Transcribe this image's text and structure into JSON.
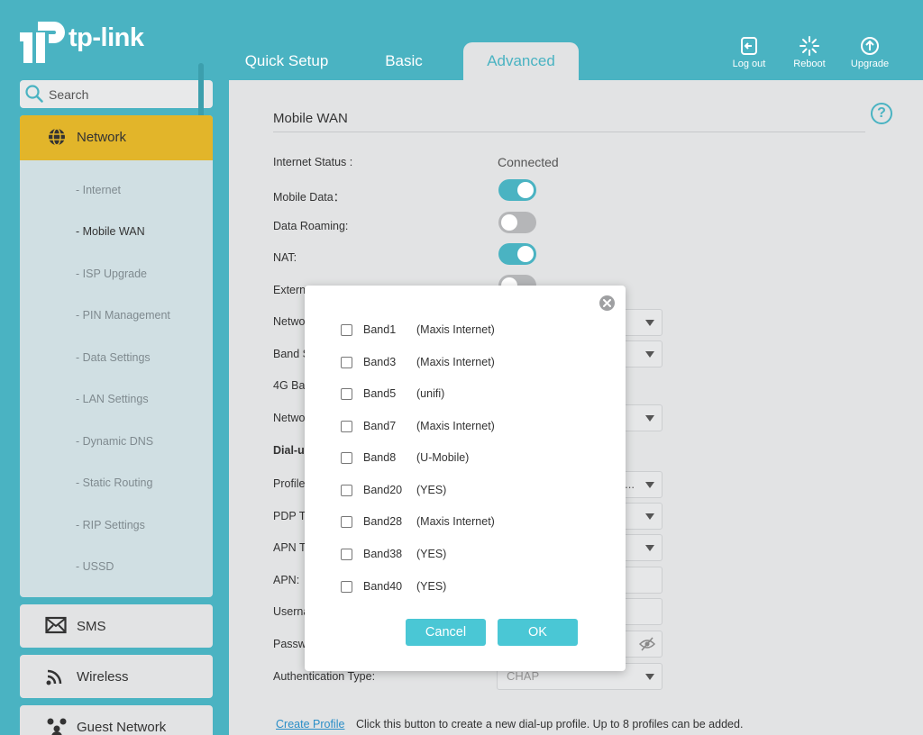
{
  "header": {
    "logo_text": "tp-link",
    "tabs": [
      {
        "label": "Quick Setup"
      },
      {
        "label": "Basic"
      },
      {
        "label": "Advanced"
      }
    ],
    "actions": [
      {
        "label": "Log out",
        "icon": "logout-icon"
      },
      {
        "label": "Reboot",
        "icon": "reboot-icon"
      },
      {
        "label": "Upgrade",
        "icon": "upgrade-icon"
      }
    ]
  },
  "sidebar": {
    "search_placeholder": "Search",
    "network_label": "Network",
    "sub_items": [
      {
        "label": "- Internet"
      },
      {
        "label": "- Mobile WAN"
      },
      {
        "label": "- ISP Upgrade"
      },
      {
        "label": "- PIN Management"
      },
      {
        "label": "- Data Settings"
      },
      {
        "label": "- LAN Settings"
      },
      {
        "label": "- Dynamic DNS"
      },
      {
        "label": "- Static Routing"
      },
      {
        "label": "- RIP Settings"
      },
      {
        "label": "- USSD"
      }
    ],
    "blocks": [
      {
        "label": "SMS",
        "icon": "envelope-icon"
      },
      {
        "label": "Wireless",
        "icon": "wifi-icon"
      },
      {
        "label": "Guest Network",
        "icon": "guest-users-icon"
      }
    ]
  },
  "content": {
    "title": "Mobile WAN",
    "internet_status_label": "Internet Status :",
    "internet_status_value": "Connected",
    "mobile_data_label": "Mobile Data：",
    "mobile_data_on": true,
    "data_roaming_label": "Data Roaming:",
    "data_roaming_on": false,
    "nat_label": "NAT:",
    "nat_on": true,
    "partial_labels": {
      "external": "Extern",
      "network1": "Netwo",
      "band_s": "Band S",
      "band_4g": "4G Ba",
      "network2": "Netwo",
      "dialup": "Dial-u",
      "profile": "Profile",
      "pdp": "PDP T",
      "apn_type": "APN T",
      "apn": "APN:",
      "username": "Userna",
      "password": "Passw"
    },
    "profile_value_tail": "u...",
    "auth_label": "Authentication Type:",
    "auth_value": "CHAP",
    "create_profile_link": "Create Profile",
    "create_profile_note": "Click this button to create a new dial-up profile. Up to 8 profiles can be added."
  },
  "modal": {
    "bands": [
      {
        "band": "Band1",
        "carrier": "(Maxis Internet)",
        "checked": false
      },
      {
        "band": "Band3",
        "carrier": "(Maxis Internet)",
        "checked": false
      },
      {
        "band": "Band5",
        "carrier": "(unifi)",
        "checked": false
      },
      {
        "band": "Band7",
        "carrier": "(Maxis Internet)",
        "checked": false
      },
      {
        "band": "Band8",
        "carrier": "(U-Mobile)",
        "checked": false
      },
      {
        "band": "Band20",
        "carrier": "(YES)",
        "checked": false
      },
      {
        "band": "Band28",
        "carrier": "(Maxis Internet)",
        "checked": false
      },
      {
        "band": "Band38",
        "carrier": "(YES)",
        "checked": false
      },
      {
        "band": "Band40",
        "carrier": "(YES)",
        "checked": false
      }
    ],
    "cancel_label": "Cancel",
    "ok_label": "OK"
  },
  "colors": {
    "brand_teal": "#4ab3c2",
    "network_highlight": "#e2b52a",
    "button_teal": "#4ac7d5",
    "link_blue": "#2a8ec7"
  }
}
